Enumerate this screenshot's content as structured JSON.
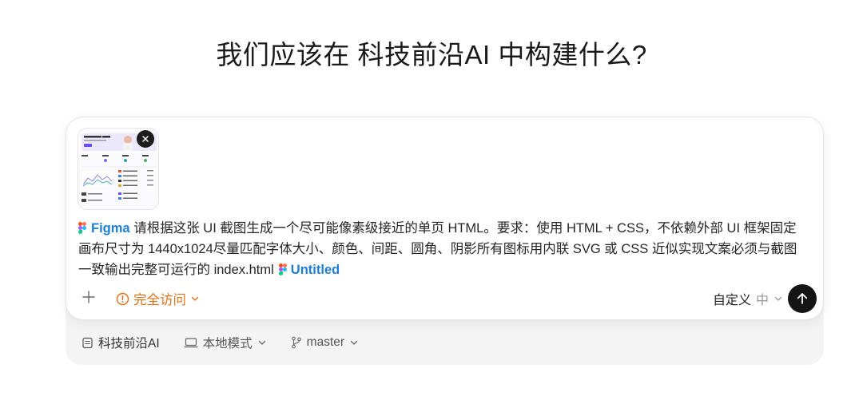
{
  "heading": "我们应该在 科技前沿AI 中构建什么?",
  "attachment": {
    "name": "screenshot-thumbnail",
    "preview_title": "Hi,Jakob Good Afternoon"
  },
  "prompt": {
    "figma_tag": "Figma",
    "text": "请根据这张 UI 截图生成一个尽可能像素级接近的单页 HTML。要求：使用 HTML + CSS，不依赖外部 UI 框架固定画布尺寸为 1440x1024尽量匹配字体大小、颜色、间距、圆角、阴影所有图标用内联 SVG 或 CSS 近似实现文案必须与截图一致输出完整可运行的 index.html",
    "untitled_tag": "Untitled"
  },
  "toolbar": {
    "access_label": "完全访问",
    "custom_label": "自定义",
    "custom_value": "中"
  },
  "meta": {
    "project": "科技前沿AI",
    "mode": "本地模式",
    "branch": "master"
  },
  "colors": {
    "accent_orange": "#e0711a",
    "tag_blue": "#1c7fd6",
    "send_bg": "#151515"
  }
}
